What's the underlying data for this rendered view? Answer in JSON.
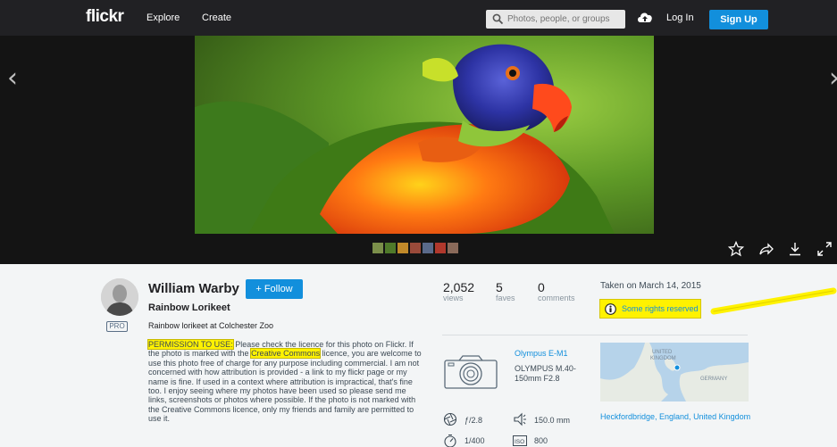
{
  "nav": {
    "logo": "flickr",
    "explore": "Explore",
    "create": "Create",
    "search_placeholder": "Photos, people, or groups",
    "login": "Log In",
    "signup": "Sign Up"
  },
  "photo": {
    "subject": "rainbow lorikeet close-up",
    "thumbnail_count": 7
  },
  "stage_icons": [
    "star-icon",
    "share-icon",
    "download-icon",
    "expand-icon"
  ],
  "author": {
    "name": "William Warby",
    "follow_label": "+ Follow",
    "badge": "PRO"
  },
  "photo_info": {
    "title": "Rainbow Lorikeet",
    "description": "Rainbow lorikeet at Colchester Zoo",
    "permission_label": "PERMISSION TO USE:",
    "body_1": " Please check the licence for this photo on Flickr. If the photo is marked with the ",
    "cc_label": "Creative Commons",
    "body_2": " licence, you are welcome to use this photo free of charge for any purpose including commercial. I am not concerned with how attribution is provided - a link to my flickr page or my name is fine. If used in a context where attribution is impractical, that's fine too. I enjoy seeing where my photos have been used so please send me links, screenshots or photos where possible. If the photo is not marked with the Creative Commons licence, only my friends and family are permitted to use it."
  },
  "stats": {
    "views_value": "2,052",
    "views_label": "views",
    "faves_value": "5",
    "faves_label": "faves",
    "comments_value": "0",
    "comments_label": "comments"
  },
  "meta": {
    "taken": "Taken on March 14, 2015",
    "rights": "Some rights reserved",
    "highlight_color": "#fff200",
    "link_color": "#128fdc"
  },
  "camera": {
    "model": "Olympus E-M1",
    "lens": "OLYMPUS M.40-150mm F2.8"
  },
  "map": {
    "label_uk": "UNITED KINGDOM",
    "label_de": "GERMANY"
  },
  "location": "Heckfordbridge, England, United Kingdom",
  "exif": {
    "aperture": "ƒ/2.8",
    "focal": "150.0 mm",
    "shutter": "1/400",
    "iso": "800"
  }
}
